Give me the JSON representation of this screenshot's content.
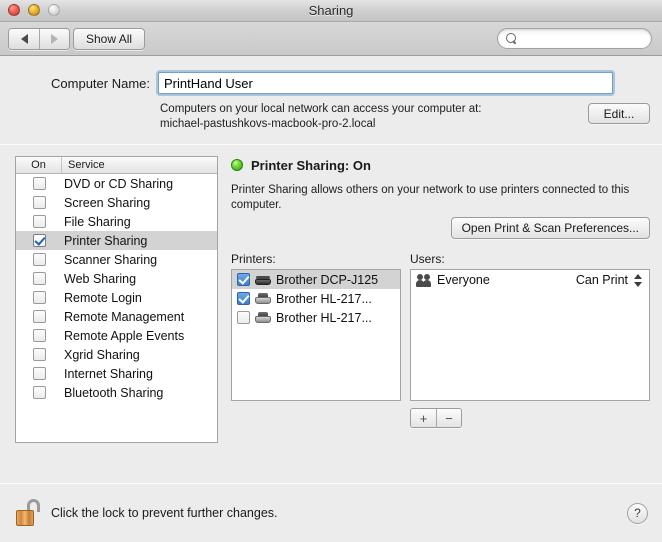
{
  "window": {
    "title": "Sharing",
    "traffic_lights": [
      "close-button",
      "minimize-button",
      "zoom-button-disabled"
    ]
  },
  "toolbar": {
    "back_label": "",
    "forward_label": "",
    "show_all_label": "Show All",
    "search_placeholder": "",
    "search_value": ""
  },
  "computer_name": {
    "label": "Computer Name:",
    "value": "PrintHand User",
    "hint_line1": "Computers on your local network can access your computer at:",
    "hint_line2": "michael-pastushkovs-macbook-pro-2.local",
    "edit_label": "Edit..."
  },
  "services": {
    "header_on": "On",
    "header_service": "Service",
    "rows": [
      {
        "label": "DVD or CD Sharing",
        "checked": false,
        "selected": false
      },
      {
        "label": "Screen Sharing",
        "checked": false,
        "selected": false
      },
      {
        "label": "File Sharing",
        "checked": false,
        "selected": false
      },
      {
        "label": "Printer Sharing",
        "checked": true,
        "selected": true
      },
      {
        "label": "Scanner Sharing",
        "checked": false,
        "selected": false
      },
      {
        "label": "Web Sharing",
        "checked": false,
        "selected": false
      },
      {
        "label": "Remote Login",
        "checked": false,
        "selected": false
      },
      {
        "label": "Remote Management",
        "checked": false,
        "selected": false
      },
      {
        "label": "Remote Apple Events",
        "checked": false,
        "selected": false
      },
      {
        "label": "Xgrid Sharing",
        "checked": false,
        "selected": false
      },
      {
        "label": "Internet Sharing",
        "checked": false,
        "selected": false
      },
      {
        "label": "Bluetooth Sharing",
        "checked": false,
        "selected": false
      }
    ]
  },
  "detail": {
    "status_text": "Printer Sharing: On",
    "status_color": "#5cc72b",
    "status_indicator": "green-status-dot",
    "description": "Printer Sharing allows others on your network to use printers connected to this computer.",
    "open_prefs_label": "Open Print & Scan Preferences...",
    "printers_label": "Printers:",
    "printers": [
      {
        "name": "Brother DCP-J125",
        "checked": true,
        "selected": true,
        "icon": "printer-flat-icon"
      },
      {
        "name": "Brother HL-217...",
        "checked": true,
        "selected": false,
        "icon": "printer-icon"
      },
      {
        "name": "Brother HL-217...",
        "checked": false,
        "selected": false,
        "icon": "printer-icon"
      }
    ],
    "users_label": "Users:",
    "users": [
      {
        "name": "Everyone",
        "permission": "Can Print",
        "icon": "users-group-icon"
      }
    ],
    "add_label": "+",
    "remove_label": "−"
  },
  "footer": {
    "lock_icon": "padlock-open-icon",
    "lock_text": "Click the lock to prevent further changes.",
    "help_label": "?"
  }
}
